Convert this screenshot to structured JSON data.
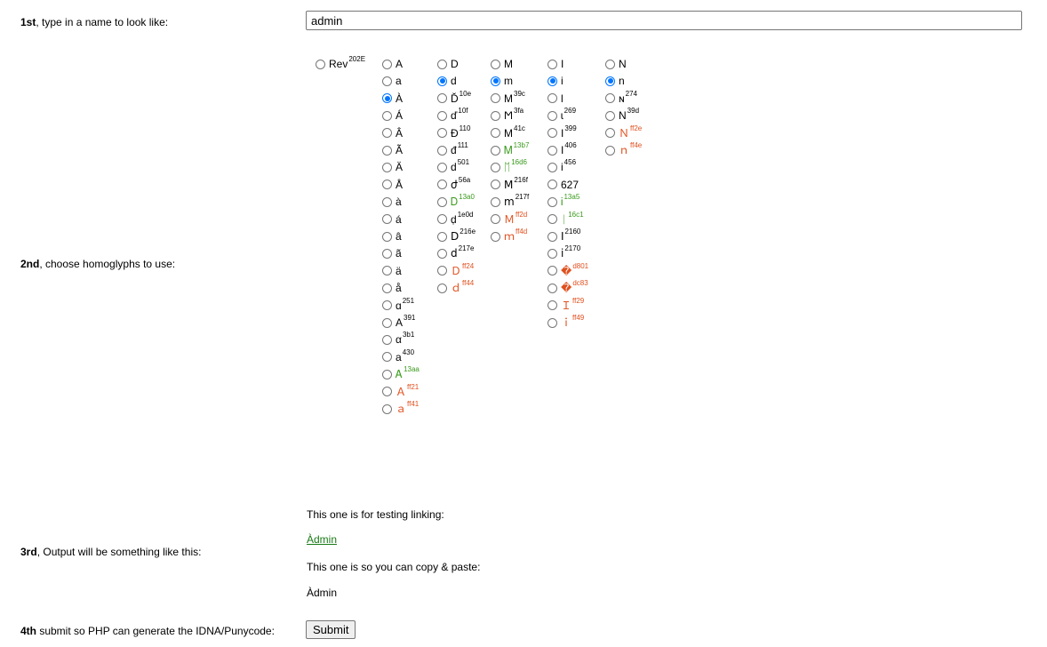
{
  "steps": {
    "step1": {
      "bold": "1st",
      "rest": ", type in a name to look like:"
    },
    "step2": {
      "bold": "2nd",
      "rest": ", choose homoglyphs to use:"
    },
    "step3": {
      "bold": "3rd",
      "rest": ", Output will be something like this:"
    },
    "step4": {
      "bold": "4th",
      "rest": " submit so PHP can generate the IDNA/Punycode:"
    }
  },
  "name_input": {
    "value": "admin"
  },
  "rev_option": {
    "glyph": "Rev",
    "code": "202E",
    "checked": false
  },
  "columns": [
    {
      "name": "a",
      "options": [
        {
          "glyph": "A",
          "code": "",
          "style": "normal",
          "checked": false
        },
        {
          "glyph": "a",
          "code": "",
          "style": "normal",
          "checked": false
        },
        {
          "glyph": "À",
          "code": "",
          "style": "normal",
          "checked": true
        },
        {
          "glyph": "Á",
          "code": "",
          "style": "normal",
          "checked": false
        },
        {
          "glyph": "Â",
          "code": "",
          "style": "normal",
          "checked": false
        },
        {
          "glyph": "Ã",
          "code": "",
          "style": "normal",
          "checked": false
        },
        {
          "glyph": "Ä",
          "code": "",
          "style": "normal",
          "checked": false
        },
        {
          "glyph": "Å",
          "code": "",
          "style": "normal",
          "checked": false
        },
        {
          "glyph": "à",
          "code": "",
          "style": "normal",
          "checked": false
        },
        {
          "glyph": "á",
          "code": "",
          "style": "normal",
          "checked": false
        },
        {
          "glyph": "â",
          "code": "",
          "style": "normal",
          "checked": false
        },
        {
          "glyph": "ã",
          "code": "",
          "style": "normal",
          "checked": false
        },
        {
          "glyph": "ä",
          "code": "",
          "style": "normal",
          "checked": false
        },
        {
          "glyph": "å",
          "code": "",
          "style": "normal",
          "checked": false
        },
        {
          "glyph": "ɑ",
          "code": "251",
          "style": "normal",
          "checked": false
        },
        {
          "glyph": "Α",
          "code": "391",
          "style": "normal",
          "checked": false
        },
        {
          "glyph": "α",
          "code": "3b1",
          "style": "normal",
          "checked": false
        },
        {
          "glyph": "а",
          "code": "430",
          "style": "normal",
          "checked": false
        },
        {
          "glyph": "Ꭺ",
          "code": "13aa",
          "style": "green",
          "checked": false
        },
        {
          "glyph": "Ａ",
          "code": "ff21",
          "style": "red",
          "checked": false
        },
        {
          "glyph": "ａ",
          "code": "ff41",
          "style": "red",
          "checked": false
        }
      ]
    },
    {
      "name": "d",
      "options": [
        {
          "glyph": "D",
          "code": "",
          "style": "normal",
          "checked": false
        },
        {
          "glyph": "d",
          "code": "",
          "style": "normal",
          "checked": true
        },
        {
          "glyph": "Ď",
          "code": "10e",
          "style": "normal",
          "checked": false
        },
        {
          "glyph": "ď",
          "code": "10f",
          "style": "normal",
          "checked": false
        },
        {
          "glyph": "Đ",
          "code": "110",
          "style": "normal",
          "checked": false
        },
        {
          "glyph": "đ",
          "code": "111",
          "style": "normal",
          "checked": false
        },
        {
          "glyph": "ԁ",
          "code": "501",
          "style": "normal",
          "checked": false
        },
        {
          "glyph": "ժ",
          "code": "56a",
          "style": "normal",
          "checked": false
        },
        {
          "glyph": "Ꭰ",
          "code": "13a0",
          "style": "green",
          "checked": false
        },
        {
          "glyph": "ḍ",
          "code": "1e0d",
          "style": "normal",
          "checked": false
        },
        {
          "glyph": "Ⅾ",
          "code": "216e",
          "style": "normal",
          "checked": false
        },
        {
          "glyph": "ⅾ",
          "code": "217e",
          "style": "normal",
          "checked": false
        },
        {
          "glyph": "Ｄ",
          "code": "ff24",
          "style": "red",
          "checked": false
        },
        {
          "glyph": "ｄ",
          "code": "ff44",
          "style": "red",
          "checked": false
        }
      ]
    },
    {
      "name": "m",
      "options": [
        {
          "glyph": "M",
          "code": "",
          "style": "normal",
          "checked": false
        },
        {
          "glyph": "m",
          "code": "",
          "style": "normal",
          "checked": true
        },
        {
          "glyph": "Μ",
          "code": "39c",
          "style": "normal",
          "checked": false
        },
        {
          "glyph": "Ϻ",
          "code": "3fa",
          "style": "normal",
          "checked": false
        },
        {
          "glyph": "М",
          "code": "41c",
          "style": "normal",
          "checked": false
        },
        {
          "glyph": "Ꮇ",
          "code": "13b7",
          "style": "green",
          "checked": false
        },
        {
          "glyph": "ᛖ",
          "code": "16d6",
          "style": "green",
          "checked": false
        },
        {
          "glyph": "Ⅿ",
          "code": "216f",
          "style": "normal",
          "checked": false
        },
        {
          "glyph": "ⅿ",
          "code": "217f",
          "style": "normal",
          "checked": false
        },
        {
          "glyph": "Ｍ",
          "code": "ff2d",
          "style": "red",
          "checked": false
        },
        {
          "glyph": "ｍ",
          "code": "ff4d",
          "style": "red",
          "checked": false
        }
      ]
    },
    {
      "name": "i",
      "options": [
        {
          "glyph": "I",
          "code": "",
          "style": "normal",
          "checked": false
        },
        {
          "glyph": "i",
          "code": "",
          "style": "normal",
          "checked": true
        },
        {
          "glyph": "l",
          "code": "",
          "style": "normal",
          "checked": false
        },
        {
          "glyph": "ɩ",
          "code": "269",
          "style": "normal",
          "checked": false
        },
        {
          "glyph": "Ι",
          "code": "399",
          "style": "normal",
          "checked": false
        },
        {
          "glyph": "І",
          "code": "406",
          "style": "normal",
          "checked": false
        },
        {
          "glyph": "і",
          "code": "456",
          "style": "normal",
          "checked": false
        },
        {
          "glyph": "627",
          "code": "",
          "style": "normal",
          "checked": false
        },
        {
          "glyph": "Ꭵ",
          "code": "13a5",
          "style": "green",
          "checked": false
        },
        {
          "glyph": "ᛁ",
          "code": "16c1",
          "style": "green",
          "checked": false
        },
        {
          "glyph": "Ⅰ",
          "code": "2160",
          "style": "normal",
          "checked": false
        },
        {
          "glyph": "ⅰ",
          "code": "2170",
          "style": "normal",
          "checked": false
        },
        {
          "glyph": "�",
          "code": "d801",
          "style": "red",
          "checked": false
        },
        {
          "glyph": "�",
          "code": "dc83",
          "style": "red",
          "checked": false
        },
        {
          "glyph": "Ｉ",
          "code": "ff29",
          "style": "red",
          "checked": false
        },
        {
          "glyph": "ｉ",
          "code": "ff49",
          "style": "red",
          "checked": false
        }
      ]
    },
    {
      "name": "n",
      "options": [
        {
          "glyph": "N",
          "code": "",
          "style": "normal",
          "checked": false
        },
        {
          "glyph": "n",
          "code": "",
          "style": "normal",
          "checked": true
        },
        {
          "glyph": "ɴ",
          "code": "274",
          "style": "normal",
          "checked": false
        },
        {
          "glyph": "Ν",
          "code": "39d",
          "style": "normal",
          "checked": false
        },
        {
          "glyph": "Ｎ",
          "code": "ff2e",
          "style": "red",
          "checked": false
        },
        {
          "glyph": "ｎ",
          "code": "ff4e",
          "style": "red",
          "checked": false
        }
      ]
    }
  ],
  "output": {
    "link_caption": "This one is for testing linking:",
    "link_text": "Àdmin",
    "copy_caption": "This one is so you can copy & paste:",
    "copy_text": "Àdmin"
  },
  "submit_label": "Submit"
}
